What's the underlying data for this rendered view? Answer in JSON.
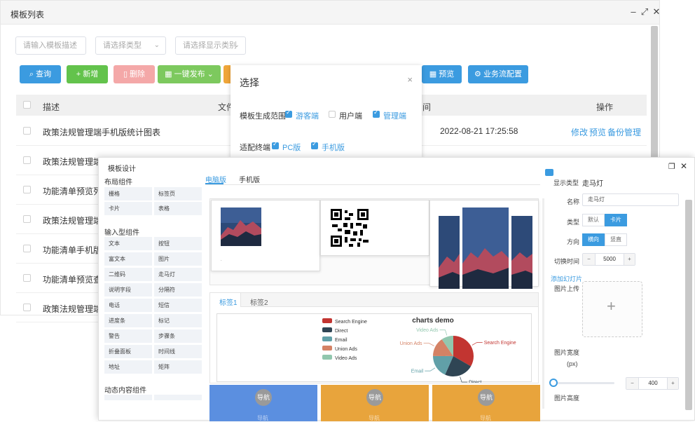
{
  "back_window": {
    "title": "模板列表",
    "filters": [
      "请输入模板描述",
      "请选择类型",
      "请选择显示类别"
    ],
    "buttons": {
      "query": "查询",
      "add": "新增",
      "delete": "删除",
      "publish": "一键发布",
      "preview": "预览",
      "workflow": "业务流配置"
    },
    "table": {
      "headers": {
        "desc": "描述",
        "file": "文件",
        "time": "间",
        "ops": "操作"
      },
      "rows": [
        {
          "desc": "政策法规管理端手机版统计图表",
          "time": "2022-08-21 17:25:58",
          "actions": [
            "修改",
            "预览",
            "备份管理"
          ]
        },
        {
          "desc": "政策法规管理端统计图表",
          "time": "",
          "actions": []
        },
        {
          "desc": "功能清单预览列表页",
          "time": "",
          "actions": []
        },
        {
          "desc": "政策法规管理端查看",
          "time": "",
          "actions": []
        },
        {
          "desc": "功能清单手机版预览",
          "time": "",
          "actions": []
        },
        {
          "desc": "功能清单预览查看页",
          "time": "",
          "actions": []
        },
        {
          "desc": "政策法规管理端手机",
          "time": "",
          "actions": []
        }
      ]
    }
  },
  "modal": {
    "title": "选择",
    "close": "×",
    "range_label": "模板生成范围",
    "range_options": [
      {
        "label": "游客端",
        "checked": true
      },
      {
        "label": "用户端",
        "checked": false
      },
      {
        "label": "管理端",
        "checked": true
      }
    ],
    "terminal_label": "适配终端",
    "terminal_options": [
      {
        "label": "PC版",
        "checked": true
      },
      {
        "label": "手机版",
        "checked": true
      }
    ]
  },
  "front_window": {
    "title": "模板设计",
    "palette": {
      "layout_title": "布局组件",
      "layout_items": [
        "栅格",
        "标签页",
        "卡片",
        "表格"
      ],
      "input_title": "输入型组件",
      "input_items": [
        "文本",
        "按钮",
        "富文本",
        "图片",
        "二维码",
        "走马灯",
        "说明字段",
        "分隔符",
        "电话",
        "短信",
        "进度条",
        "标记",
        "警告",
        "步骤条",
        "折叠面板",
        "时间线",
        "地址",
        "矩阵"
      ],
      "dynamic_title": "动态内容组件"
    },
    "canvas_tabs": {
      "pc": "电脑版",
      "mobile": "手机版"
    },
    "inner_tabs": [
      "标签1",
      "标签2"
    ],
    "chart_card_title": "charts demo",
    "nav_blocks": [
      {
        "label": "导航",
        "sub": "导航",
        "color": "#5b8fe0"
      },
      {
        "label": "导航",
        "sub": "导航",
        "color": "#e8a43c"
      },
      {
        "label": "导航",
        "sub": "导航",
        "color": "#e8a43c"
      }
    ],
    "props": {
      "component_type_label": "显示类型",
      "component_type_value": "走马灯",
      "name_label": "名称",
      "name_value": "走马灯",
      "type_label": "类型",
      "type_options": [
        "默认",
        "卡片"
      ],
      "direction_label": "方向",
      "direction_options": [
        "横向",
        "竖直"
      ],
      "interval_label": "切换时间",
      "interval_value": "5000",
      "add_slide": "添加幻灯片",
      "image_upload_label": "图片上传",
      "image_width_label": "图片宽度",
      "image_width_unit": "(px)",
      "slider_value": "400",
      "image_height_label": "图片高度"
    }
  },
  "chart_data": {
    "type": "pie",
    "title": "charts demo",
    "legend": [
      "Search Engine",
      "Direct",
      "Email",
      "Union Ads",
      "Video Ads"
    ],
    "values": [
      1048,
      735,
      580,
      484,
      300
    ],
    "colors": [
      "#c23531",
      "#2f4554",
      "#61a0a8",
      "#d48265",
      "#91c7ae"
    ],
    "legend_position": "left"
  }
}
